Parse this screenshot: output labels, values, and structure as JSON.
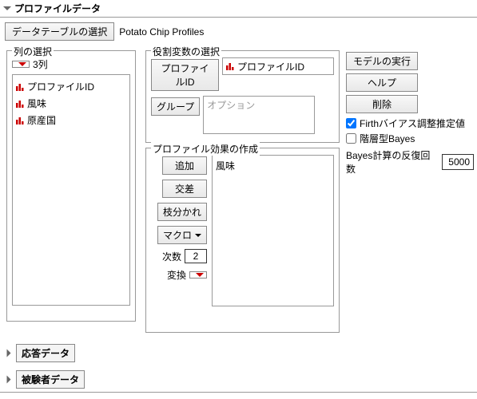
{
  "title": "プロファイルデータ",
  "dataTable": {
    "pickerLabel": "データテーブルの選択",
    "value": "Potato Chip Profiles"
  },
  "columnSelect": {
    "legend": "列の選択",
    "countLabel": "3列",
    "items": [
      "プロファイルID",
      "風味",
      "原産国"
    ]
  },
  "roleSelect": {
    "legend": "役割変数の選択",
    "profileId": {
      "btn": "プロファイルID",
      "value": "プロファイルID"
    },
    "group": {
      "btn": "グループ",
      "placeholder": "オプション"
    }
  },
  "actions": {
    "run": "モデルの実行",
    "help": "ヘルプ",
    "remove": "削除"
  },
  "options": {
    "firth": {
      "label": "Firthバイアス調整推定値",
      "checked": true
    },
    "hierBayes": {
      "label": "階層型Bayes",
      "checked": false
    },
    "bayesIter": {
      "label": "Bayes計算の反復回数",
      "value": "5000"
    }
  },
  "effects": {
    "legend": "プロファイル効果の作成",
    "add": "追加",
    "cross": "交差",
    "nest": "枝分かれ",
    "macro": "マクロ",
    "degree": {
      "label": "次数",
      "value": "2"
    },
    "transform": "変換",
    "items": [
      "風味"
    ]
  },
  "footer": {
    "response": "応答データ",
    "subject": "被験者データ"
  }
}
